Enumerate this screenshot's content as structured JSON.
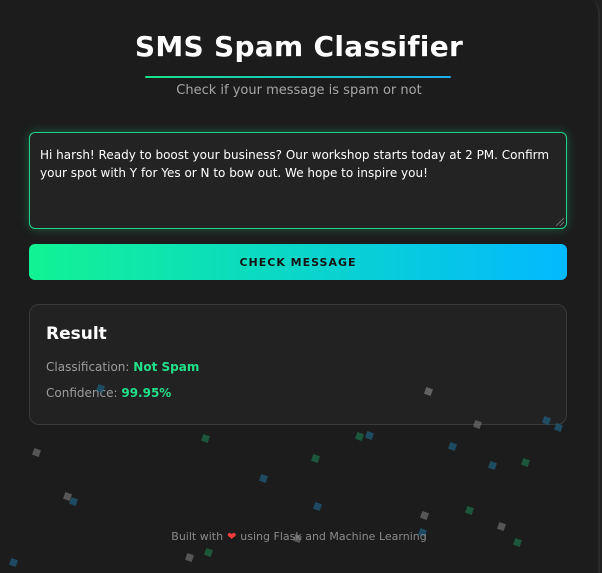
{
  "app": {
    "title": "SMS Spam Classifier",
    "subtitle": "Check if your message is spam or not"
  },
  "form": {
    "message": "Hi harsh! Ready to boost your business? Our workshop starts today at 2 PM. Confirm your spot with Y for Yes or N to bow out. We hope to inspire you!",
    "submit_label": "CHECK MESSAGE"
  },
  "result": {
    "title": "Result",
    "classification_label": "Classification:",
    "classification_value": "Not Spam",
    "confidence_label": "Confidence:",
    "confidence_value": "99.95%"
  },
  "footer": {
    "prefix": "Built with",
    "suffix": "using Flask and Machine Learning"
  },
  "colors": {
    "accent_green": "#22e08a",
    "accent_blue": "#03b9ff",
    "background": "#1c1c1c"
  },
  "icons": {
    "heart": "heart-icon"
  }
}
